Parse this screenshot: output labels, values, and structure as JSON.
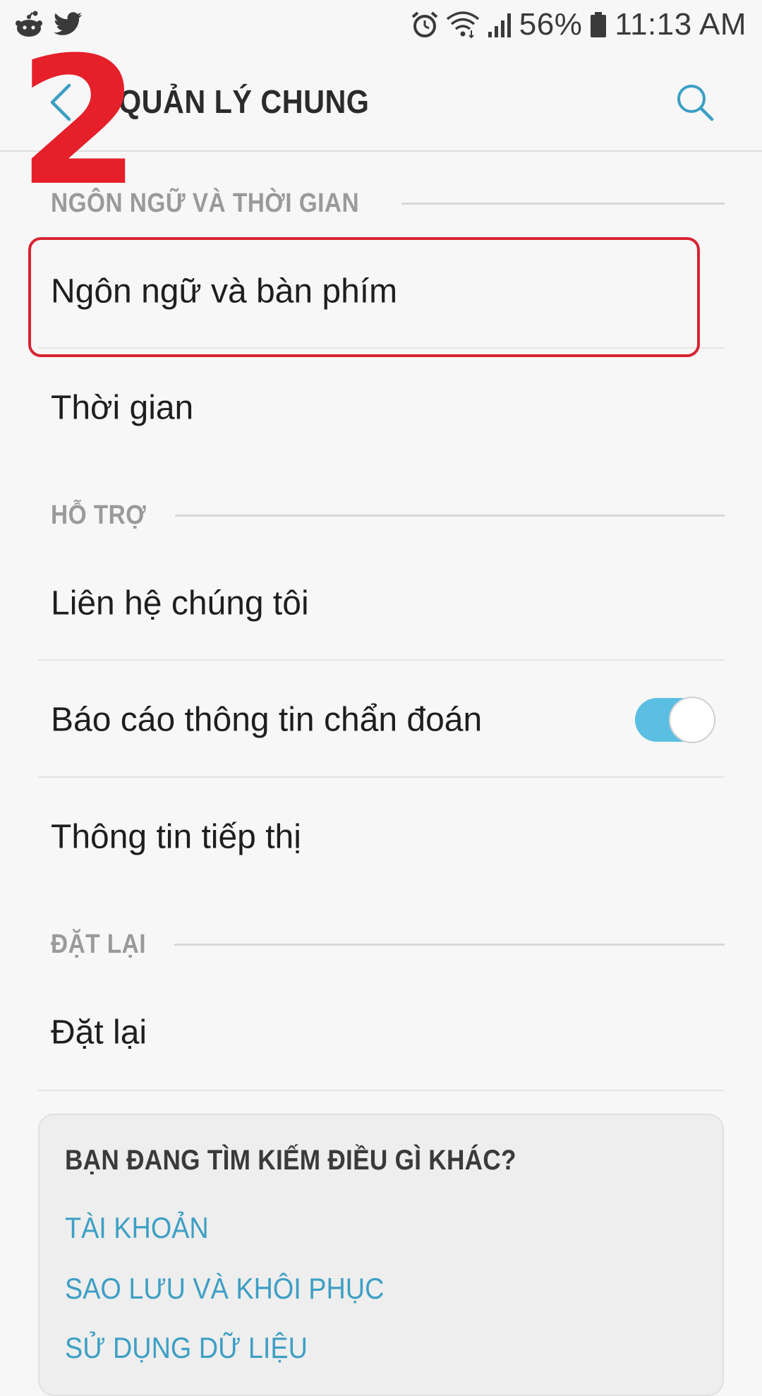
{
  "status_bar": {
    "left_icons": [
      "reddit-icon",
      "twitter-icon"
    ],
    "right_icons": [
      "alarm-icon",
      "wifi-icon",
      "signal-icon",
      "battery-icon"
    ],
    "battery": "56%",
    "time": "11:13 AM"
  },
  "header": {
    "title": "QUẢN LÝ CHUNG",
    "back_icon": "chevron-left-icon",
    "search_icon": "search-icon"
  },
  "annotation": {
    "step": "2",
    "color": "#e5202a"
  },
  "sections": {
    "language_time": {
      "header": "NGÔN NGỮ VÀ THỜI GIAN",
      "items": [
        "Ngôn ngữ và bàn phím",
        "Thời gian"
      ]
    },
    "support": {
      "header": "HỖ TRỢ",
      "items": [
        "Liên hệ chúng tôi",
        "Báo cáo thông tin chẩn đoán",
        "Thông tin tiếp thị"
      ],
      "diagnostic_toggle_on": true
    },
    "reset": {
      "header": "ĐẶT LẠI",
      "items": [
        "Đặt lại"
      ]
    }
  },
  "suggestion_card": {
    "title": "BẠN ĐANG TÌM KIẾM ĐIỀU GÌ KHÁC?",
    "links": [
      "TÀI KHOẢN",
      "SAO LƯU VÀ KHÔI PHỤC",
      "SỬ DỤNG DỮ LIỆU"
    ]
  },
  "colors": {
    "accent": "#3d9fc4",
    "toggle_on": "#5bbfe3",
    "highlight": "#d62533"
  }
}
